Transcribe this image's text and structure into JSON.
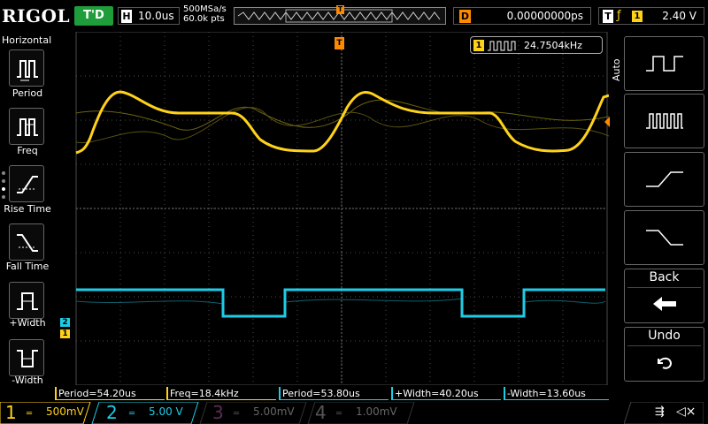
{
  "topbar": {
    "logo": "RIGOL",
    "run_state": "T'D",
    "horizontal": {
      "label": "H",
      "value": "10.0us"
    },
    "sample_rate": "500MSa/s",
    "memory_depth": "60.0k pts",
    "trigger_marker": "T",
    "delay": {
      "label": "D",
      "value": "0.00000000ps"
    },
    "trigger": {
      "label": "T",
      "source": "1",
      "level": "2.40 V"
    }
  },
  "left_menu": {
    "title": "Horizontal",
    "items": [
      {
        "label": "Period",
        "icon": "period-icon"
      },
      {
        "label": "Freq",
        "icon": "frequency-icon"
      },
      {
        "label": "Rise Time",
        "icon": "rise-time-icon"
      },
      {
        "label": "Fall Time",
        "icon": "fall-time-icon"
      },
      {
        "label": "+Width",
        "icon": "positive-width-icon"
      },
      {
        "label": "-Width",
        "icon": "negative-width-icon"
      }
    ]
  },
  "screen": {
    "frequency_counter": {
      "channel": "1",
      "value": "24.7504kHz"
    },
    "trigger_level_marker": "T",
    "ch1_marker": "1",
    "ch2_marker": "2"
  },
  "right_panel": {
    "mode": "Auto",
    "buttons": [
      {
        "icon": "square-wave-icon"
      },
      {
        "icon": "pulse-train-icon"
      },
      {
        "icon": "rising-edge-icon"
      },
      {
        "icon": "falling-edge-icon"
      }
    ],
    "back_label": "Back",
    "undo_label": "Undo"
  },
  "measurements": [
    {
      "text": "Period=54.20us",
      "color": "yellow"
    },
    {
      "text": "Freq=18.4kHz",
      "color": "yellow"
    },
    {
      "text": "Period=53.80us",
      "color": "cyan"
    },
    {
      "text": "+Width=40.20us",
      "color": "cyan"
    },
    {
      "text": "-Width=13.60us",
      "color": "cyan"
    }
  ],
  "channels": [
    {
      "num": "1",
      "scale": "500mV",
      "color": "#ffd21a",
      "active": true
    },
    {
      "num": "2",
      "scale": "5.00 V",
      "color": "#1ecce6",
      "active": true
    },
    {
      "num": "3",
      "scale": "5.00mV",
      "color": "#b03b9a",
      "active": false
    },
    {
      "num": "4",
      "scale": "1.00mV",
      "color": "#3a5bd6",
      "active": false
    }
  ],
  "colors": {
    "ch1": "#ffd21a",
    "ch2": "#1ecce6",
    "trigger": "#ff8a00",
    "run": "#1f9d3a"
  }
}
